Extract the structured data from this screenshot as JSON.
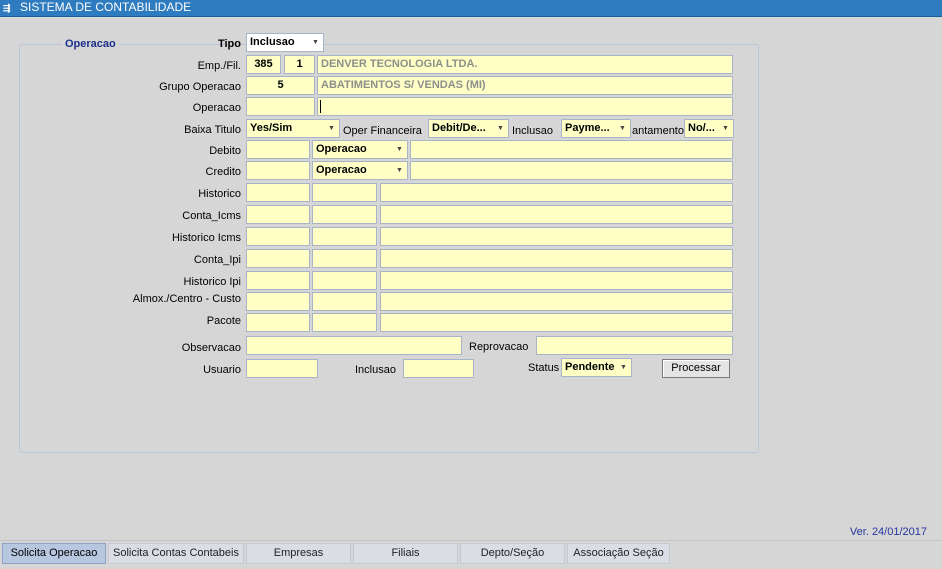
{
  "window": {
    "title": "SISTEMA DE CONTABILIDADE",
    "icon": "app-window-icon"
  },
  "form": {
    "group_title": "Operacao",
    "tipo": {
      "label": "Tipo",
      "value": "Inclusao"
    },
    "emp_fil": {
      "label": "Emp./Fil.",
      "emp": "385",
      "fil": "1",
      "name": "DENVER TECNOLOGIA LTDA."
    },
    "grupo_operacao": {
      "label": "Grupo Operacao",
      "code": "5",
      "name": "ABATIMENTOS S/ VENDAS (MI)"
    },
    "operacao": {
      "label": "Operacao",
      "code": "",
      "name": ""
    },
    "baixa_titulo": {
      "label": "Baixa Titulo",
      "value": "Yes/Sim"
    },
    "oper_financeira": {
      "label": "Oper Financeira",
      "value": "Debit/De..."
    },
    "inclusao_combo": {
      "label": "Inclusao",
      "value": "Payme..."
    },
    "lancamento": {
      "label": "antamento",
      "value": "No/..."
    },
    "debito": {
      "label": "Debito",
      "code": "",
      "type": "Operacao",
      "desc": ""
    },
    "credito": {
      "label": "Credito",
      "code": "",
      "type": "Operacao",
      "desc": ""
    },
    "historico": {
      "label": "Historico"
    },
    "conta_icms": {
      "label": "Conta_Icms"
    },
    "historico_icms": {
      "label": "Historico Icms"
    },
    "conta_ipi": {
      "label": "Conta_Ipi"
    },
    "historico_ipi": {
      "label": "Historico Ipi"
    },
    "almox": {
      "label": "Almox./Centro - Custo"
    },
    "pacote": {
      "label": "Pacote"
    },
    "observacao": {
      "label": "Observacao",
      "value": ""
    },
    "reprovacao": {
      "label": "Reprovacao",
      "value": ""
    },
    "usuario": {
      "label": "Usuario",
      "value": ""
    },
    "inclusao": {
      "label": "Inclusao",
      "value": ""
    },
    "status": {
      "label": "Status",
      "value": "Pendente"
    },
    "processar_label": "Processar"
  },
  "version": "Ver. 24/01/2017",
  "tabs": [
    {
      "label": "Solicita Operacao",
      "active": true
    },
    {
      "label": "Solicita Contas Contabeis",
      "active": false
    },
    {
      "label": "Empresas",
      "active": false
    },
    {
      "label": "Filiais",
      "active": false
    },
    {
      "label": "Depto/Seção",
      "active": false
    },
    {
      "label": "Associação Seção",
      "active": false
    }
  ],
  "colors": {
    "titlebar": "#2e7bbf",
    "field": "#ffffc6",
    "version_text": "#2535a0"
  }
}
